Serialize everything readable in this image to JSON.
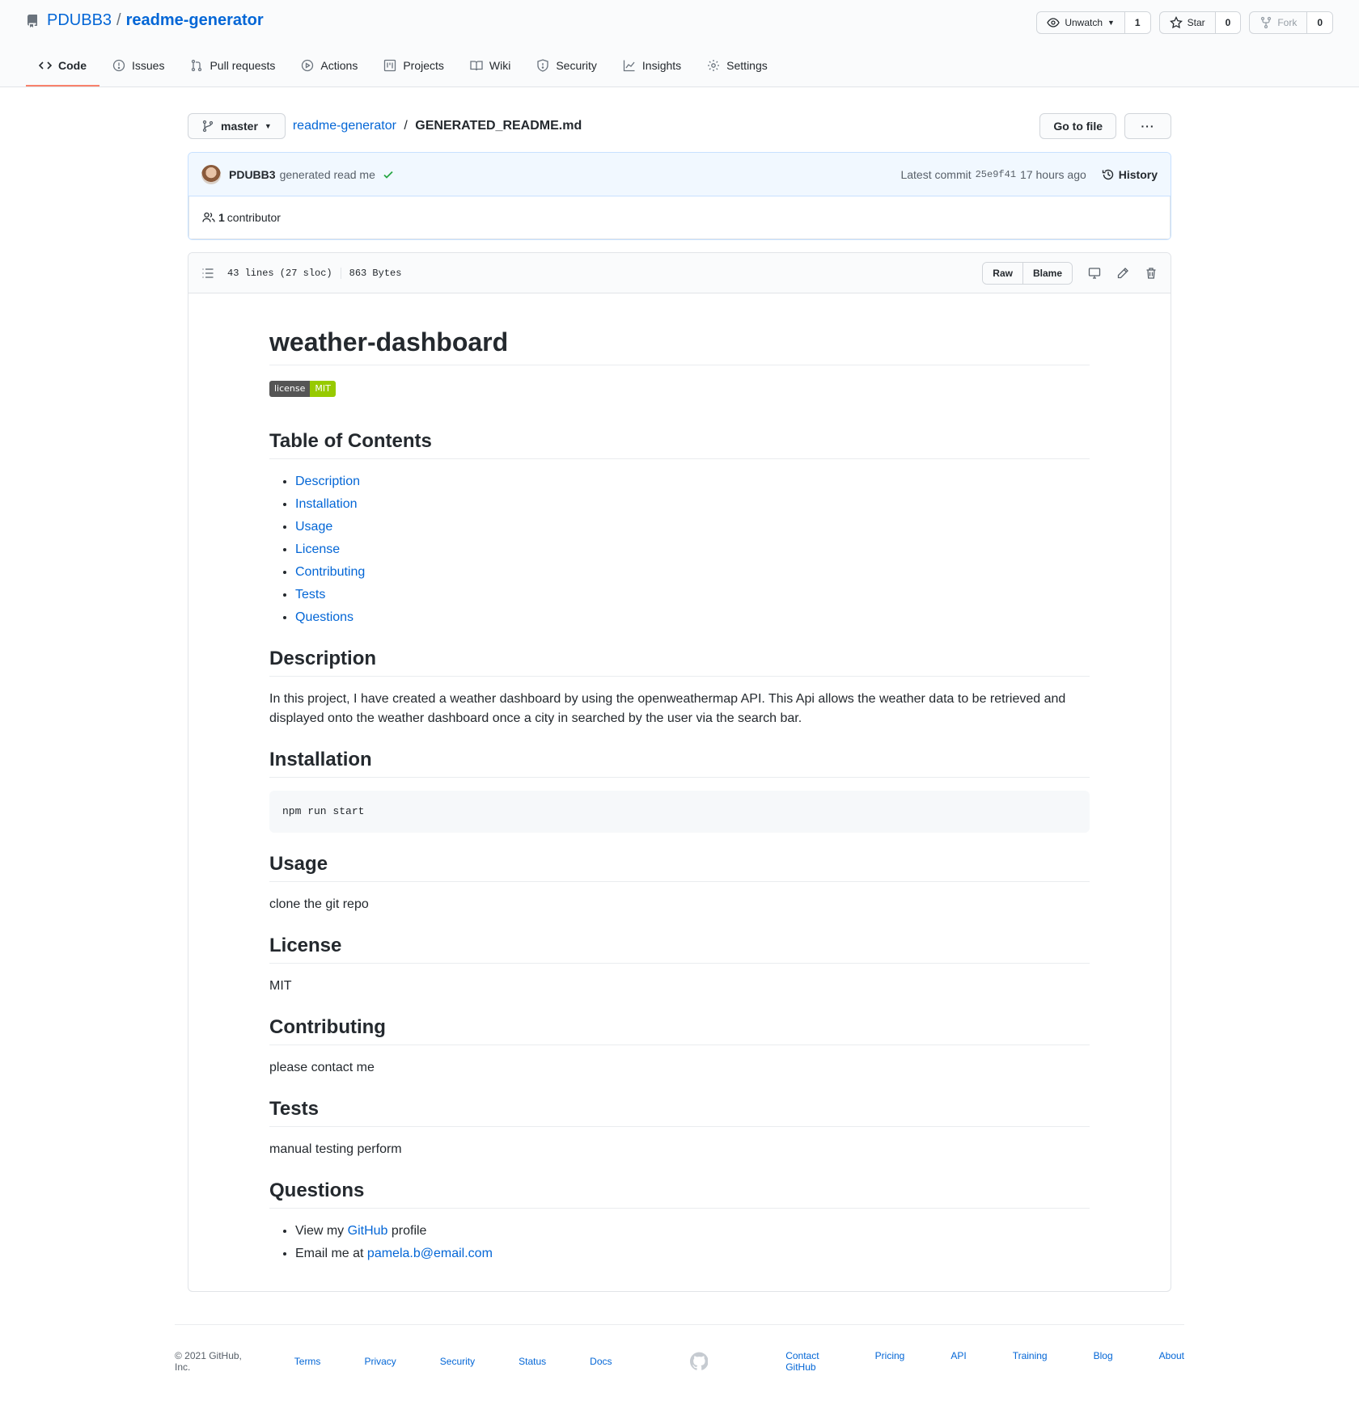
{
  "repo": {
    "owner": "PDUBB3",
    "separator": "/",
    "name": "readme-generator"
  },
  "actions": {
    "watch": {
      "label": "Unwatch",
      "count": "1"
    },
    "star": {
      "label": "Star",
      "count": "0"
    },
    "fork": {
      "label": "Fork",
      "count": "0"
    }
  },
  "tabs": [
    {
      "label": "Code",
      "icon": "code-icon",
      "active": true
    },
    {
      "label": "Issues",
      "icon": "issue-icon"
    },
    {
      "label": "Pull requests",
      "icon": "pull-request-icon"
    },
    {
      "label": "Actions",
      "icon": "play-icon"
    },
    {
      "label": "Projects",
      "icon": "project-icon"
    },
    {
      "label": "Wiki",
      "icon": "book-icon"
    },
    {
      "label": "Security",
      "icon": "shield-icon"
    },
    {
      "label": "Insights",
      "icon": "graph-icon"
    },
    {
      "label": "Settings",
      "icon": "gear-icon"
    }
  ],
  "filebar": {
    "branch": "master",
    "crumb_repo": "readme-generator",
    "crumb_sep": "/",
    "crumb_file": "GENERATED_README.md",
    "goto_label": "Go to file",
    "more_label": "···"
  },
  "commit": {
    "author": "PDUBB3",
    "message": "generated read me",
    "latest_label": "Latest commit",
    "sha": "25e9f41",
    "time": "17 hours ago",
    "history_label": "History",
    "contributors_count": "1",
    "contributors_label": "contributor"
  },
  "file": {
    "lines": "43 lines (27 sloc)",
    "size": "863 Bytes",
    "raw_label": "Raw",
    "blame_label": "Blame"
  },
  "readme": {
    "title": "weather-dashboard",
    "badge_left": "license",
    "badge_right": "MIT",
    "toc_heading": "Table of Contents",
    "toc": [
      "Description",
      "Installation",
      "Usage",
      "License",
      "Contributing",
      "Tests",
      "Questions"
    ],
    "description_heading": "Description",
    "description_text": "In this project, I have created a weather dashboard by using the openweathermap API. This Api allows the weather data to be retrieved and displayed onto the weather dashboard once a city in searched by the user via the search bar.",
    "installation_heading": "Installation",
    "installation_code": "npm run start",
    "usage_heading": "Usage",
    "usage_text": "clone the git repo",
    "license_heading": "License",
    "license_text": "MIT",
    "contributing_heading": "Contributing",
    "contributing_text": "please contact me",
    "tests_heading": "Tests",
    "tests_text": "manual testing perform",
    "questions_heading": "Questions",
    "q1_prefix": "View my",
    "q1_link": "GitHub",
    "q1_suffix": "profile",
    "q2_prefix": "Email me at",
    "q2_link": "pamela.b@email.com"
  },
  "footer": {
    "copyright": "© 2021 GitHub, Inc.",
    "left_links": [
      "Terms",
      "Privacy",
      "Security",
      "Status",
      "Docs"
    ],
    "right_links": [
      "Contact GitHub",
      "Pricing",
      "API",
      "Training",
      "Blog",
      "About"
    ]
  },
  "colors": {
    "link": "#0366d6",
    "active_tab": "#f9826c",
    "commit_bg": "#f1f8ff",
    "badge_green": "#97ca00",
    "check_green": "#28a745"
  }
}
